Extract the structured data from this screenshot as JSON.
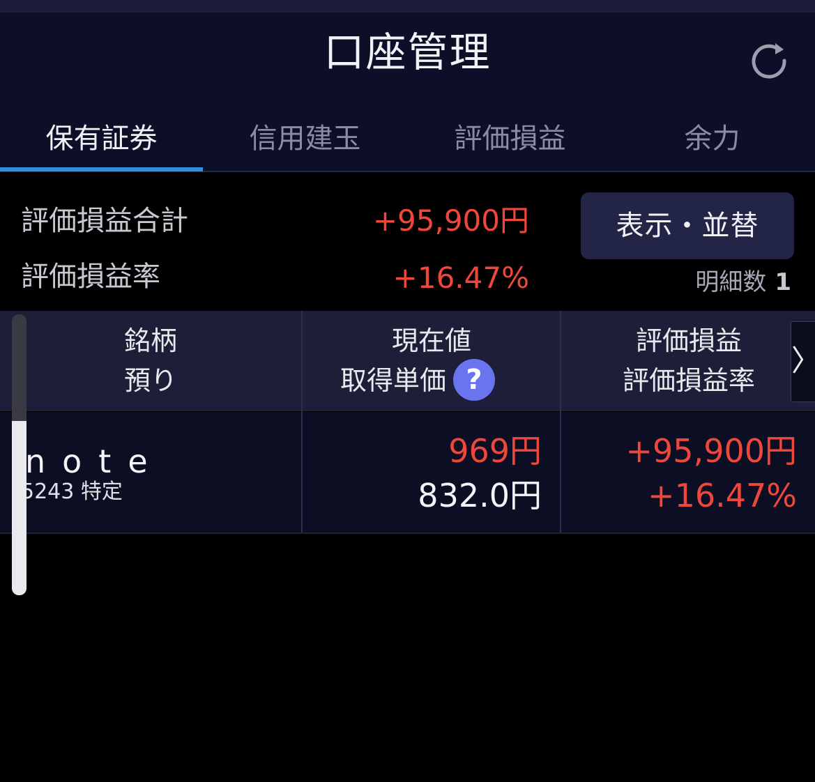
{
  "header": {
    "title": "口座管理",
    "refresh_icon": "refresh-icon"
  },
  "tabs": [
    {
      "label": "保有証券",
      "active": true
    },
    {
      "label": "信用建玉",
      "active": false
    },
    {
      "label": "評価損益",
      "active": false
    },
    {
      "label": "余力",
      "active": false
    }
  ],
  "summary": {
    "total_label": "評価損益合計",
    "total_value": "+95,900円",
    "rate_label": "評価損益率",
    "rate_value": "+16.47%",
    "sort_button": "表示・並替",
    "detail_count_label": "明細数",
    "detail_count": "1"
  },
  "table": {
    "headers": [
      {
        "line1": "銘柄",
        "line2": "預り"
      },
      {
        "line1": "現在値",
        "line2": "取得単価",
        "help_icon": "?"
      },
      {
        "line1": "評価損益",
        "line2": "評価損益率"
      }
    ],
    "next_arrow": "〉",
    "rows": [
      {
        "name": "note",
        "code_account": "5243 特定",
        "current_price": "969円",
        "acquisition_price": "832.0円",
        "pnl": "+95,900円",
        "pnl_rate": "+16.47%"
      }
    ]
  },
  "colors": {
    "header_bg": "#0c0f27",
    "accent": "#2f8fe0",
    "profit_red": "#f0473d",
    "button_bg": "#232546",
    "help_icon": "#6a74ee"
  }
}
